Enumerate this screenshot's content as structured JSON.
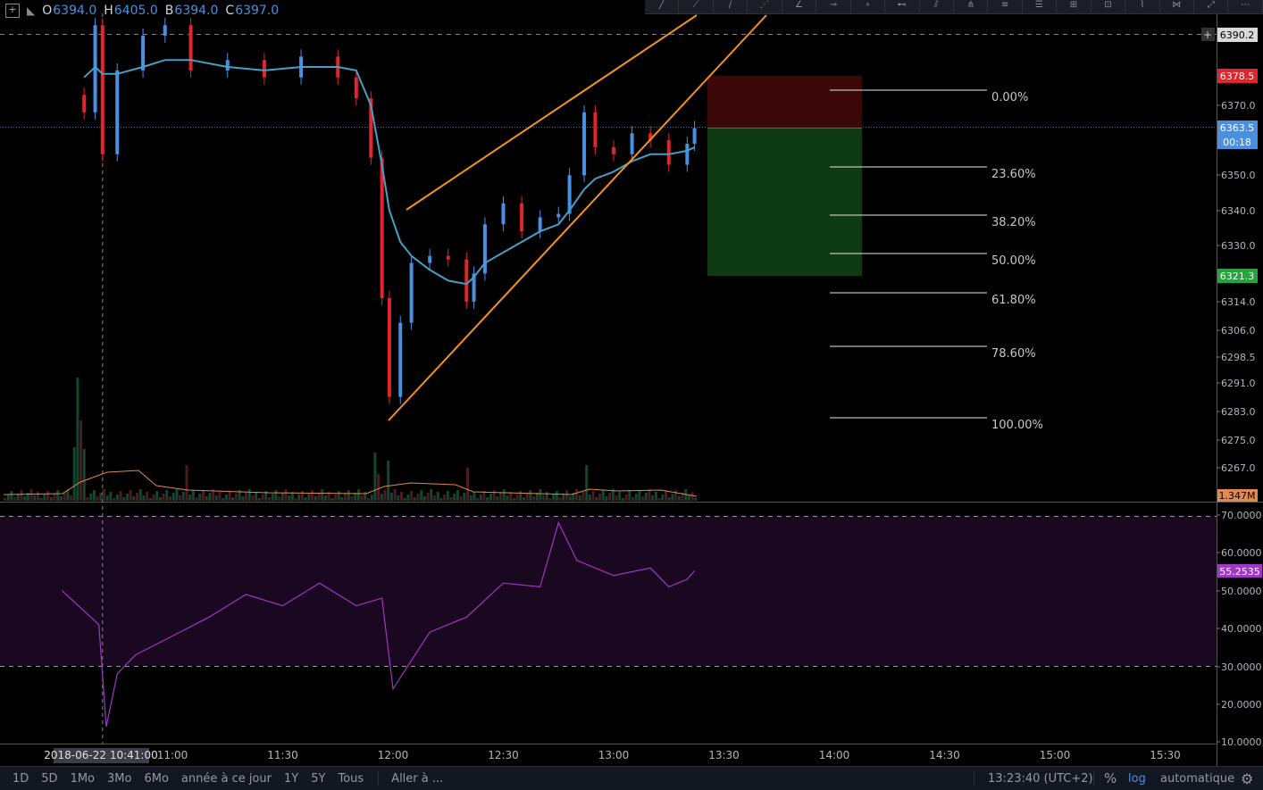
{
  "ohlc": {
    "o_label": "O",
    "o": "6394.0",
    "h_label": "H",
    "h": "6405.0",
    "b_label": "B",
    "b": "6394.0",
    "c_label": "C",
    "c": "6397.0"
  },
  "colors": {
    "up": "#4a90e2",
    "down": "#e0262b",
    "ema": "#46a0c8",
    "wedge": "#f7931a",
    "rsi": "#a335c8",
    "rsi_band": "#1a0720",
    "vol_ma": "#e08a52",
    "tp_zone": "#0d3a12",
    "sl_zone": "#3a0808",
    "grid": "#444"
  },
  "bottom_bar": {
    "ranges": [
      "1D",
      "5D",
      "1Mo",
      "3Mo",
      "6Mo",
      "année à ce jour",
      "1Y",
      "5Y",
      "Tous"
    ],
    "goto": "Aller à ...",
    "clock": "13:23:40 (UTC+2)",
    "percent": "%",
    "log": "log",
    "auto": "automatique"
  },
  "chart_data": [
    {
      "type": "candlestick",
      "title": "",
      "x_ticks": [
        "11:00",
        "11:30",
        "12:00",
        "12:30",
        "13:00",
        "13:30",
        "14:00",
        "14:30",
        "15:00",
        "15:30"
      ],
      "crosshair_time": "2018-06-22 10:41:00",
      "y_ticks": [
        "6370.0",
        "6360.0",
        "6350.0",
        "6340.0",
        "6330.0",
        "6314.0",
        "6306.0",
        "6298.5",
        "6291.0",
        "6283.0",
        "6275.0",
        "6267.0"
      ],
      "y_scale": "log",
      "price_labels": [
        {
          "text": "6390.2",
          "kind": "alert"
        },
        {
          "text": "6378.5",
          "kind": "stop"
        },
        {
          "text": "6363.5",
          "kind": "last"
        },
        {
          "text": "00:18",
          "kind": "countdown"
        },
        {
          "text": "6321.3",
          "kind": "target"
        }
      ],
      "candles_x": [
        "10:36",
        "10:39",
        "10:41",
        "10:45",
        "10:52",
        "10:58",
        "11:05",
        "11:15",
        "11:25",
        "11:35",
        "11:45",
        "11:50",
        "11:54",
        "11:57",
        "11:59",
        "12:02",
        "12:05",
        "12:10",
        "12:15",
        "12:20",
        "12:22",
        "12:25",
        "12:30",
        "12:35",
        "12:40",
        "12:45",
        "12:48",
        "12:52",
        "12:55",
        "13:00",
        "13:05",
        "13:10",
        "13:15",
        "13:20",
        "13:22"
      ],
      "close": [
        6368,
        6393,
        6356,
        6380,
        6390,
        6393,
        6380,
        6383,
        6378,
        6384,
        6378,
        6372,
        6355,
        6315,
        6287,
        6308,
        6325,
        6327,
        6326,
        6314,
        6322,
        6336,
        6342,
        6334,
        6338,
        6339,
        6350,
        6368,
        6358,
        6356,
        6362,
        6360,
        6353,
        6359,
        6363.5
      ],
      "ema_20": [
        6378,
        6381,
        6379,
        6379,
        6381,
        6383,
        6383,
        6381,
        6380,
        6381,
        6381,
        6380,
        6370,
        6353,
        6340,
        6331,
        6327,
        6323,
        6320,
        6319,
        6321,
        6325,
        6328,
        6331,
        6334,
        6336,
        6340,
        6346,
        6349,
        6351,
        6354,
        6356,
        6356,
        6357,
        6358
      ],
      "volume_label": "1.347M",
      "wedge": "rising wedge",
      "fibonacci": [
        "0.00%",
        "23.60%",
        "38.20%",
        "50.00%",
        "61.80%",
        "78.60%",
        "100.00%"
      ],
      "short_position": {
        "entry": 6363.5,
        "stop": 6378.5,
        "target": 6321.3
      }
    },
    {
      "type": "line",
      "title": "",
      "indicator": "RSI",
      "y_ticks": [
        "70.0000",
        "60.0000",
        "50.0000",
        "40.0000",
        "30.0000",
        "20.0000",
        "10.0000"
      ],
      "bands": [
        30,
        70
      ],
      "last_value": "55.2535",
      "x": [
        "10:30",
        "10:40",
        "10:42",
        "10:45",
        "10:50",
        "11:00",
        "11:10",
        "11:20",
        "11:30",
        "11:40",
        "11:50",
        "11:57",
        "12:00",
        "12:10",
        "12:20",
        "12:30",
        "12:40",
        "12:45",
        "12:50",
        "13:00",
        "13:10",
        "13:15",
        "13:20",
        "13:22"
      ],
      "values": [
        50,
        41,
        14,
        28,
        33,
        38,
        43,
        49,
        46,
        52,
        46,
        48,
        24,
        39,
        43,
        52,
        51,
        68,
        58,
        54,
        56,
        51,
        53,
        55.25
      ]
    }
  ]
}
